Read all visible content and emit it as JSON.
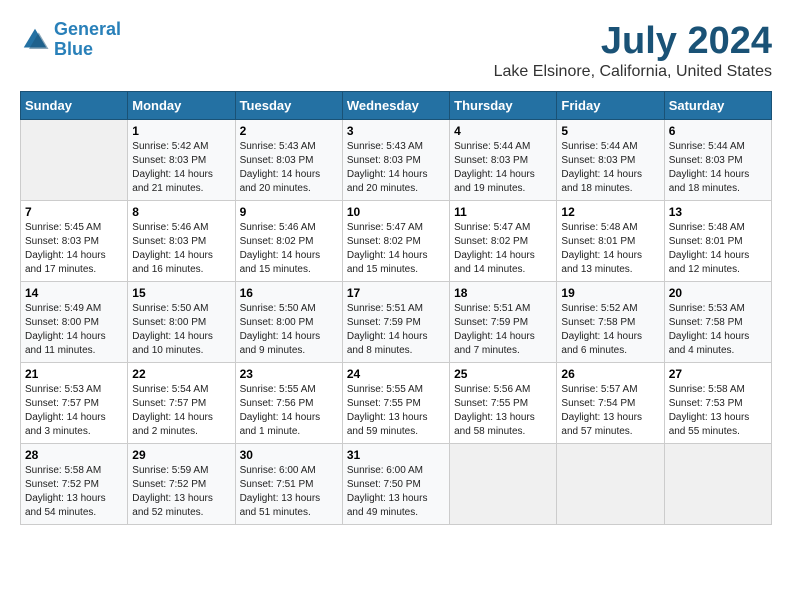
{
  "logo": {
    "line1": "General",
    "line2": "Blue"
  },
  "title": "July 2024",
  "subtitle": "Lake Elsinore, California, United States",
  "days_of_week": [
    "Sunday",
    "Monday",
    "Tuesday",
    "Wednesday",
    "Thursday",
    "Friday",
    "Saturday"
  ],
  "weeks": [
    [
      {
        "day": "",
        "empty": true
      },
      {
        "day": "1",
        "sunrise": "5:42 AM",
        "sunset": "8:03 PM",
        "daylight": "14 hours and 21 minutes."
      },
      {
        "day": "2",
        "sunrise": "5:43 AM",
        "sunset": "8:03 PM",
        "daylight": "14 hours and 20 minutes."
      },
      {
        "day": "3",
        "sunrise": "5:43 AM",
        "sunset": "8:03 PM",
        "daylight": "14 hours and 20 minutes."
      },
      {
        "day": "4",
        "sunrise": "5:44 AM",
        "sunset": "8:03 PM",
        "daylight": "14 hours and 19 minutes."
      },
      {
        "day": "5",
        "sunrise": "5:44 AM",
        "sunset": "8:03 PM",
        "daylight": "14 hours and 18 minutes."
      },
      {
        "day": "6",
        "sunrise": "5:44 AM",
        "sunset": "8:03 PM",
        "daylight": "14 hours and 18 minutes."
      }
    ],
    [
      {
        "day": "7",
        "sunrise": "5:45 AM",
        "sunset": "8:03 PM",
        "daylight": "14 hours and 17 minutes."
      },
      {
        "day": "8",
        "sunrise": "5:46 AM",
        "sunset": "8:03 PM",
        "daylight": "14 hours and 16 minutes."
      },
      {
        "day": "9",
        "sunrise": "5:46 AM",
        "sunset": "8:02 PM",
        "daylight": "14 hours and 15 minutes."
      },
      {
        "day": "10",
        "sunrise": "5:47 AM",
        "sunset": "8:02 PM",
        "daylight": "14 hours and 15 minutes."
      },
      {
        "day": "11",
        "sunrise": "5:47 AM",
        "sunset": "8:02 PM",
        "daylight": "14 hours and 14 minutes."
      },
      {
        "day": "12",
        "sunrise": "5:48 AM",
        "sunset": "8:01 PM",
        "daylight": "14 hours and 13 minutes."
      },
      {
        "day": "13",
        "sunrise": "5:48 AM",
        "sunset": "8:01 PM",
        "daylight": "14 hours and 12 minutes."
      }
    ],
    [
      {
        "day": "14",
        "sunrise": "5:49 AM",
        "sunset": "8:00 PM",
        "daylight": "14 hours and 11 minutes."
      },
      {
        "day": "15",
        "sunrise": "5:50 AM",
        "sunset": "8:00 PM",
        "daylight": "14 hours and 10 minutes."
      },
      {
        "day": "16",
        "sunrise": "5:50 AM",
        "sunset": "8:00 PM",
        "daylight": "14 hours and 9 minutes."
      },
      {
        "day": "17",
        "sunrise": "5:51 AM",
        "sunset": "7:59 PM",
        "daylight": "14 hours and 8 minutes."
      },
      {
        "day": "18",
        "sunrise": "5:51 AM",
        "sunset": "7:59 PM",
        "daylight": "14 hours and 7 minutes."
      },
      {
        "day": "19",
        "sunrise": "5:52 AM",
        "sunset": "7:58 PM",
        "daylight": "14 hours and 6 minutes."
      },
      {
        "day": "20",
        "sunrise": "5:53 AM",
        "sunset": "7:58 PM",
        "daylight": "14 hours and 4 minutes."
      }
    ],
    [
      {
        "day": "21",
        "sunrise": "5:53 AM",
        "sunset": "7:57 PM",
        "daylight": "14 hours and 3 minutes."
      },
      {
        "day": "22",
        "sunrise": "5:54 AM",
        "sunset": "7:57 PM",
        "daylight": "14 hours and 2 minutes."
      },
      {
        "day": "23",
        "sunrise": "5:55 AM",
        "sunset": "7:56 PM",
        "daylight": "14 hours and 1 minute."
      },
      {
        "day": "24",
        "sunrise": "5:55 AM",
        "sunset": "7:55 PM",
        "daylight": "13 hours and 59 minutes."
      },
      {
        "day": "25",
        "sunrise": "5:56 AM",
        "sunset": "7:55 PM",
        "daylight": "13 hours and 58 minutes."
      },
      {
        "day": "26",
        "sunrise": "5:57 AM",
        "sunset": "7:54 PM",
        "daylight": "13 hours and 57 minutes."
      },
      {
        "day": "27",
        "sunrise": "5:58 AM",
        "sunset": "7:53 PM",
        "daylight": "13 hours and 55 minutes."
      }
    ],
    [
      {
        "day": "28",
        "sunrise": "5:58 AM",
        "sunset": "7:52 PM",
        "daylight": "13 hours and 54 minutes."
      },
      {
        "day": "29",
        "sunrise": "5:59 AM",
        "sunset": "7:52 PM",
        "daylight": "13 hours and 52 minutes."
      },
      {
        "day": "30",
        "sunrise": "6:00 AM",
        "sunset": "7:51 PM",
        "daylight": "13 hours and 51 minutes."
      },
      {
        "day": "31",
        "sunrise": "6:00 AM",
        "sunset": "7:50 PM",
        "daylight": "13 hours and 49 minutes."
      },
      {
        "day": "",
        "empty": true
      },
      {
        "day": "",
        "empty": true
      },
      {
        "day": "",
        "empty": true
      }
    ]
  ]
}
